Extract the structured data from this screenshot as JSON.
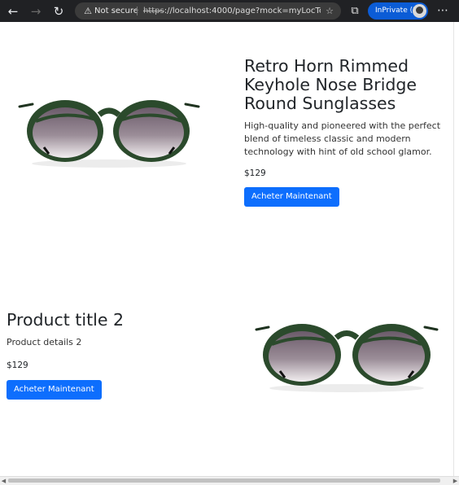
{
  "browser": {
    "back_icon": "back-arrow-icon",
    "forward_icon": "forward-arrow-icon",
    "refresh_icon": "refresh-icon",
    "security_label": "Not secure",
    "url_scheme": "https",
    "url_rest": "://localhost:4000/page?mock=myLocTestPag...",
    "inprivate_label": "InPrivate (2)",
    "accent_color": "#0b5cd6"
  },
  "products": [
    {
      "title": "Retro Horn Rimmed Keyhole Nose Bridge Round Sunglasses",
      "description": "High-quality and pioneered with the perfect blend of timeless classic and modern technology with hint of old school glamor.",
      "price": "$129",
      "button_label": "Acheter Maintenant"
    },
    {
      "title": "Product title 2",
      "description": "Product details 2",
      "price": "$129",
      "button_label": "Acheter Maintenant"
    }
  ],
  "colors": {
    "button_bg": "#0d6efd",
    "frame_green": "#2b4a2c"
  }
}
